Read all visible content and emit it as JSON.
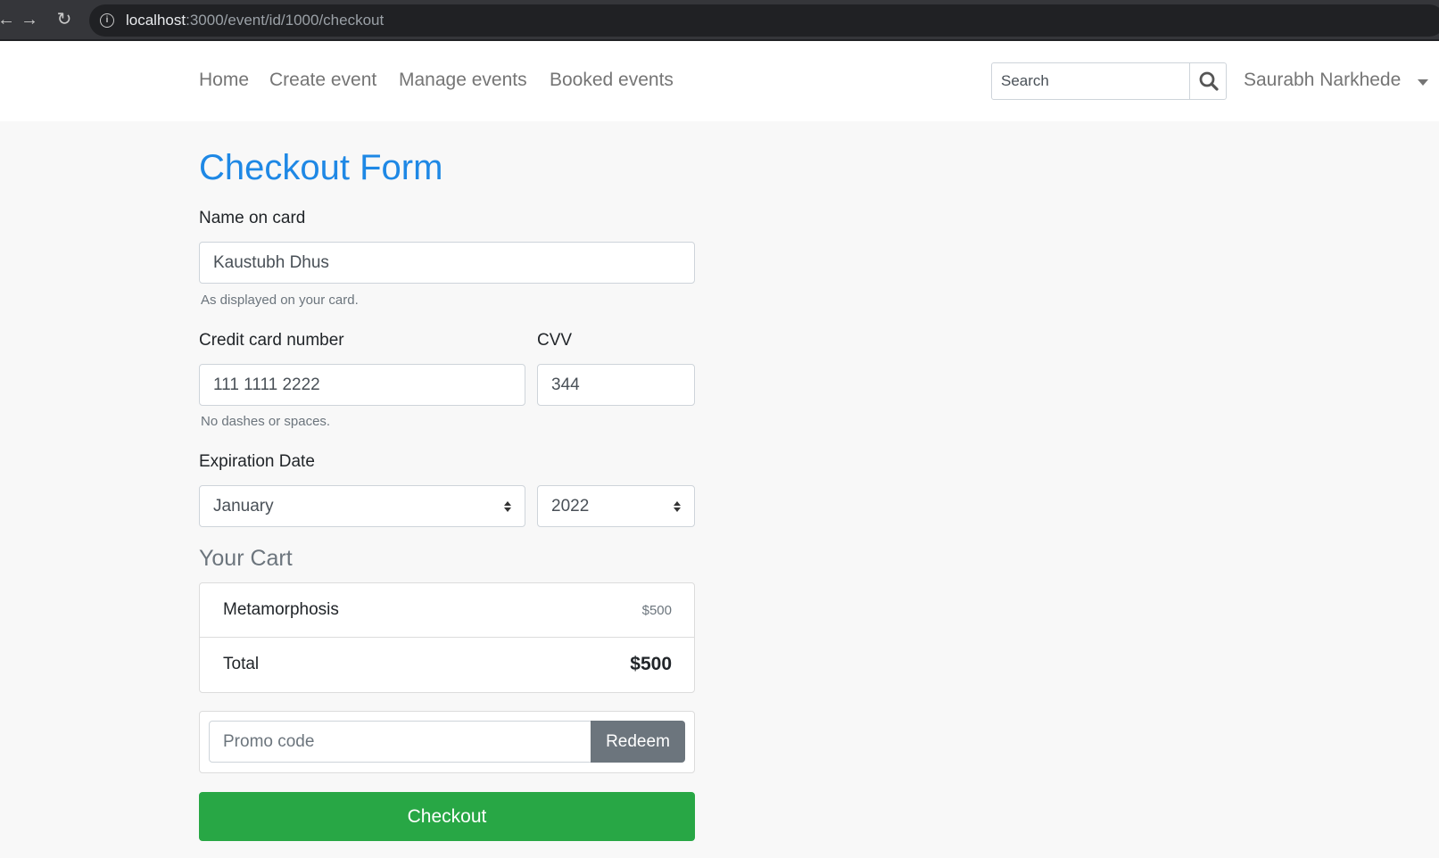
{
  "browser": {
    "url_host": "localhost",
    "url_path": ":3000/event/id/1000/checkout"
  },
  "navbar": {
    "links": [
      "Home",
      "Create event",
      "Manage events",
      "Booked events"
    ],
    "search_placeholder": "Search",
    "user_name": "Saurabh Narkhede"
  },
  "form": {
    "title": "Checkout Form",
    "name_label": "Name on card",
    "name_value": "Kaustubh Dhus",
    "name_help": "As displayed on your card.",
    "card_label": "Credit card number",
    "card_value": "111 1111 2222",
    "card_help": "No dashes or spaces.",
    "cvv_label": "CVV",
    "cvv_value": "344",
    "expiry_label": "Expiration Date",
    "expiry_month": "January",
    "expiry_year": "2022"
  },
  "cart": {
    "title": "Your Cart",
    "item_name": "Metamorphosis",
    "item_price": "$500",
    "total_label": "Total",
    "total_value": "$500"
  },
  "promo": {
    "placeholder": "Promo code",
    "redeem_label": "Redeem"
  },
  "checkout_label": "Checkout",
  "colors": {
    "title": "#1e88e5",
    "checkout": "#28a745",
    "redeem": "#6c757d"
  }
}
